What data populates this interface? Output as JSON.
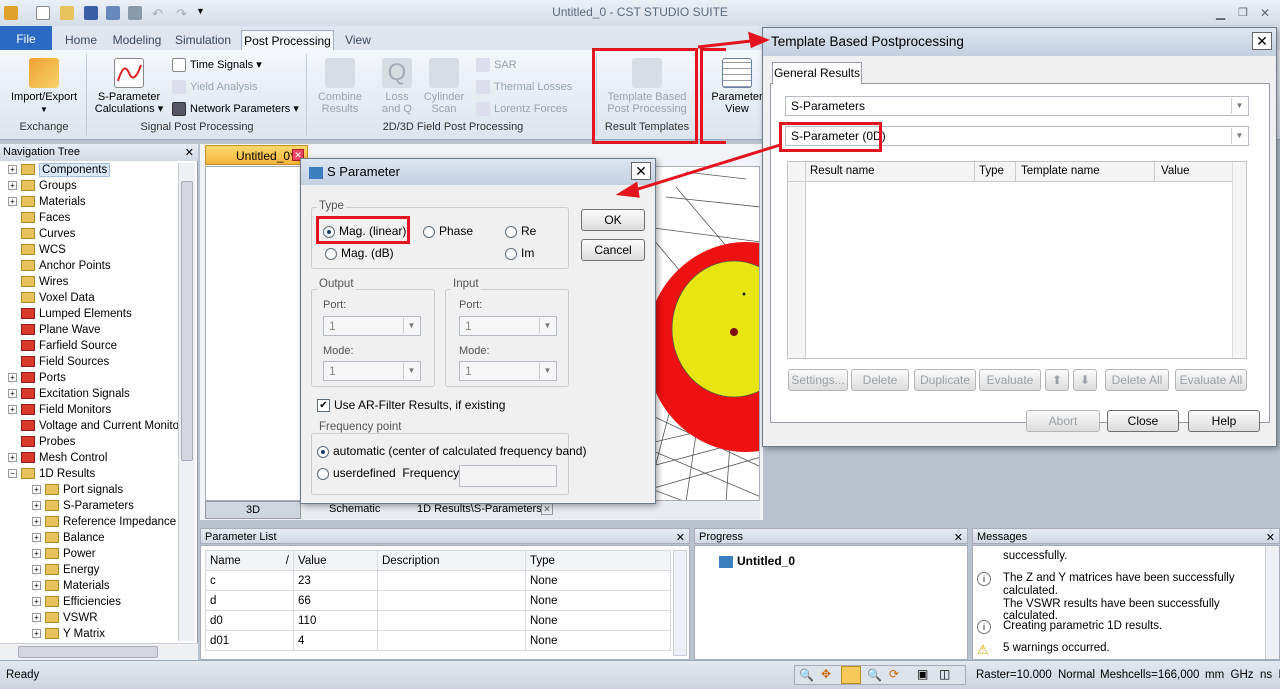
{
  "window": {
    "title": "Untitled_0 - CST STUDIO SUITE"
  },
  "ribbon": {
    "tabs": [
      "File",
      "Home",
      "Modeling",
      "Simulation",
      "Post Processing",
      "View"
    ],
    "import_export": "Import/Export",
    "exchange_group": "Exchange",
    "sparam_calc": "S-Parameter",
    "sparam_calc2": "Calculations",
    "time_signals": "Time Signals",
    "yield_analysis": "Yield Analysis",
    "network_params": "Network Parameters",
    "signal_group": "Signal Post Processing",
    "combine": "Combine",
    "combine2": "Results",
    "loss": "Loss",
    "loss2": "and Q",
    "cyl": "Cylinder",
    "cyl2": "Scan",
    "sar": "SAR",
    "thermal": "Thermal Losses",
    "lorentz": "Lorentz Forces",
    "field_group": "2D/3D Field Post Processing",
    "tbpp": "Template Based",
    "tbpp2": "Post Processing",
    "result_templates": "Result Templates",
    "param_view": "Parameter",
    "param_view2": "View"
  },
  "nav": {
    "title": "Navigation Tree",
    "items": [
      "Components",
      "Groups",
      "Materials",
      "Faces",
      "Curves",
      "WCS",
      "Anchor Points",
      "Wires",
      "Voxel Data",
      "Lumped Elements",
      "Plane Wave",
      "Farfield Source",
      "Field Sources",
      "Ports",
      "Excitation Signals",
      "Field Monitors",
      "Voltage and Current Monitors",
      "Probes",
      "Mesh Control",
      "1D Results",
      "Port signals",
      "S-Parameters",
      "Reference Impedance",
      "Balance",
      "Power",
      "Energy",
      "Materials",
      "Efficiencies",
      "VSWR",
      "Y Matrix"
    ]
  },
  "doc": {
    "tab": "Untitled_0*",
    "view_tabs": [
      "3D",
      "Schematic",
      "1D Results\\S-Parameters"
    ]
  },
  "sparam_dialog": {
    "title": "S Parameter",
    "type_label": "Type",
    "mag_linear": "Mag. (linear)",
    "phase": "Phase",
    "re": "Re",
    "mag_db": "Mag. (dB)",
    "im": "Im",
    "output_label": "Output",
    "input_label": "Input",
    "port_label": "Port:",
    "mode_label": "Mode:",
    "port_value": "1",
    "mode_value": "1",
    "ar_filter": "Use AR-Filter Results, if existing",
    "freq_label": "Frequency point",
    "auto": "automatic (center of calculated frequency band)",
    "userdef": "userdefined",
    "freq": "Frequency:",
    "ok": "OK",
    "cancel": "Cancel"
  },
  "template_dialog": {
    "title": "Template Based Postprocessing",
    "tab": "General Results",
    "combo1": "S-Parameters",
    "combo2": "S-Parameter (0D)",
    "columns": [
      "Result name",
      "Type",
      "Template name",
      "Value"
    ],
    "buttons": [
      "Settings...",
      "Delete",
      "Duplicate",
      "Evaluate",
      "Delete All",
      "Evaluate All"
    ],
    "abort": "Abort",
    "close": "Close",
    "help": "Help"
  },
  "param_list": {
    "title": "Parameter List",
    "columns": [
      "Name",
      "/",
      "Value",
      "Description",
      "Type"
    ],
    "rows": [
      [
        "c",
        "23",
        "",
        "None"
      ],
      [
        "d",
        "66",
        "",
        "None"
      ],
      [
        "d0",
        "110",
        "",
        "None"
      ],
      [
        "d01",
        "4",
        "",
        "None"
      ]
    ]
  },
  "progress": {
    "title": "Progress",
    "item": "Untitled_0"
  },
  "messages": {
    "title": "Messages",
    "items": [
      "successfully.",
      "The Z and Y matrices have been successfully calculated.",
      "The VSWR results have been successfully calculated.",
      "Creating parametric 1D results.",
      "5 warnings occurred."
    ]
  },
  "status": {
    "ready": "Ready",
    "raster": "Raster=10.000",
    "normal": "Normal",
    "meshcells": "Meshcells=166,000",
    "units": "mm  GHz  ns  K"
  },
  "colors": {
    "accent": "#2a6ac4",
    "highlight": "#e3141f"
  }
}
